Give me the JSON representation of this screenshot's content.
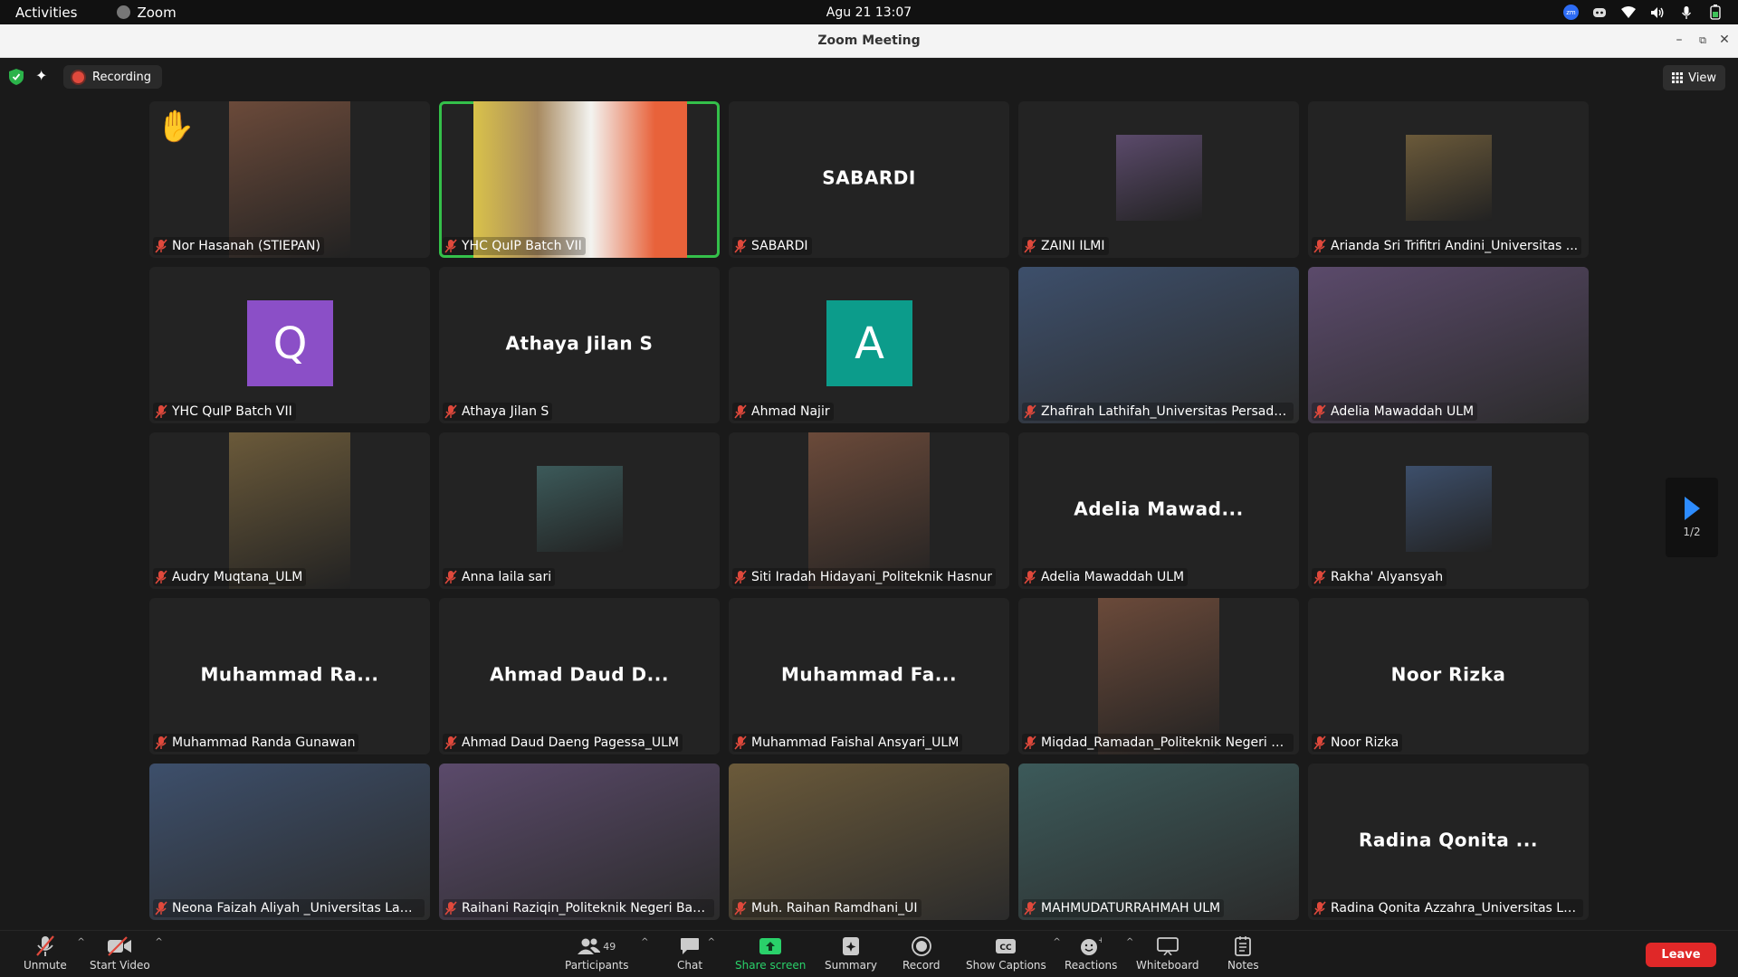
{
  "topbar": {
    "activities": "Activities",
    "app_name": "Zoom",
    "clock": "Agu 21  13:07"
  },
  "window": {
    "title": "Zoom Meeting"
  },
  "header": {
    "recording_label": "Recording",
    "view_label": "View"
  },
  "tiles": [
    {
      "name": "Nor Hasanah (STIEPAN)",
      "type": "photo",
      "hand_raised": true
    },
    {
      "name": "YHC QuIP Batch VII",
      "type": "video",
      "active_speaker": true
    },
    {
      "name": "SABARDI",
      "type": "name",
      "display": "SABARDI"
    },
    {
      "name": "ZAINI ILMI",
      "type": "photo"
    },
    {
      "name": "Arianda Sri Trifitri Andini_Universitas ...",
      "type": "photo"
    },
    {
      "name": "YHC QuIP Batch VII",
      "type": "avatar",
      "initial": "Q",
      "color": "#8b4fc7"
    },
    {
      "name": "Athaya Jilan S",
      "type": "name",
      "display": "Athaya Jilan S"
    },
    {
      "name": "Ahmad Najir",
      "type": "avatar",
      "initial": "A",
      "color": "#0c9c8b"
    },
    {
      "name": "Zhafirah Lathifah_Universitas Persada...",
      "type": "video"
    },
    {
      "name": "Adelia Mawaddah ULM",
      "type": "video"
    },
    {
      "name": "Audry Muqtana_ULM",
      "type": "photo"
    },
    {
      "name": "Anna laila sari",
      "type": "photo"
    },
    {
      "name": "Siti Iradah Hidayani_Politeknik Hasnur",
      "type": "photo"
    },
    {
      "name": "Adelia Mawaddah ULM",
      "type": "name",
      "display": "Adelia Mawad..."
    },
    {
      "name": "Rakha' Alyansyah",
      "type": "photo"
    },
    {
      "name": "Muhammad Randa Gunawan",
      "type": "name",
      "display": "Muhammad Ra..."
    },
    {
      "name": "Ahmad Daud Daeng Pagessa_ULM",
      "type": "name",
      "display": "Ahmad Daud D..."
    },
    {
      "name": "Muhammad Faishal Ansyari_ULM",
      "type": "name",
      "display": "Muhammad Fa..."
    },
    {
      "name": "Miqdad_Ramadan_Politeknik Negeri B...",
      "type": "photo"
    },
    {
      "name": "Noor Rizka",
      "type": "name",
      "display": "Noor Rizka"
    },
    {
      "name": "Neona Faizah Aliyah _Universitas Lam...",
      "type": "video"
    },
    {
      "name": "Raihani Raziqin_Politeknik Negeri Banj...",
      "type": "video"
    },
    {
      "name": "Muh. Raihan Ramdhani_UI",
      "type": "video"
    },
    {
      "name": "MAHMUDATURRAHMAH ULM",
      "type": "video"
    },
    {
      "name": "Radina Qonita Azzahra_Universitas La...",
      "type": "name",
      "display": "Radina Qonita ..."
    }
  ],
  "pager": {
    "page": "1/2"
  },
  "toolbar": {
    "unmute": "Unmute",
    "start_video": "Start Video",
    "participants": "Participants",
    "participants_count": "49",
    "chat": "Chat",
    "share_screen": "Share screen",
    "summary": "Summary",
    "record": "Record",
    "show_captions": "Show Captions",
    "reactions": "Reactions",
    "whiteboard": "Whiteboard",
    "notes": "Notes",
    "leave": "Leave"
  },
  "colors": {
    "background": "#1a1a1a",
    "tile": "#232323",
    "active_border": "#34c04a",
    "leave": "#e02828",
    "share_green": "#2ad16a",
    "mute_red": "#e0493c"
  }
}
